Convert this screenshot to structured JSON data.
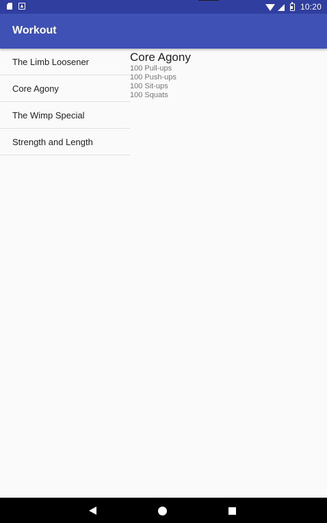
{
  "status_bar": {
    "time": "10:20",
    "icons": [
      "sd-card-icon",
      "a-icon",
      "wifi-icon",
      "signal-icon",
      "battery-icon"
    ]
  },
  "app_bar": {
    "title": "Workout"
  },
  "workout_list": {
    "items": [
      {
        "label": "The Limb Loosener"
      },
      {
        "label": "Core Agony"
      },
      {
        "label": "The Wimp Special"
      },
      {
        "label": "Strength and Length"
      }
    ]
  },
  "detail": {
    "title": "Core Agony",
    "lines": [
      "100 Pull-ups",
      "100 Push-ups",
      "100 Sit-ups",
      "100 Squats"
    ]
  },
  "nav_bar": {
    "icons": [
      "back-icon",
      "home-icon",
      "recents-icon"
    ]
  },
  "colors": {
    "status_bar": "#303f9f",
    "app_bar": "#3f51b5",
    "background": "#fafafa",
    "nav_bar": "#000000"
  }
}
